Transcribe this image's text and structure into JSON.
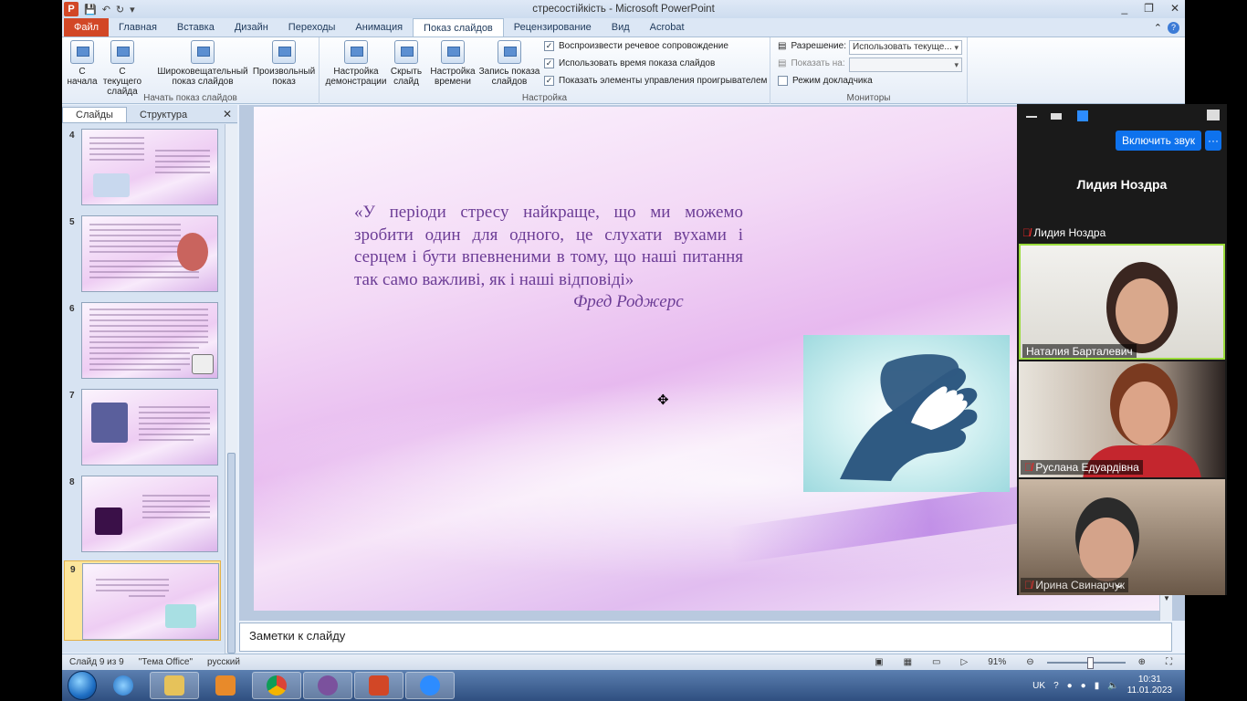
{
  "window": {
    "title": "стресостійкість - Microsoft PowerPoint",
    "controls": [
      "_",
      "❐",
      "✕"
    ]
  },
  "ribbon_tabs": [
    "Файл",
    "Главная",
    "Вставка",
    "Дизайн",
    "Переходы",
    "Анимация",
    "Показ слайдов",
    "Рецензирование",
    "Вид",
    "Acrobat"
  ],
  "active_tab": "Показ слайдов",
  "ribbon": {
    "group_start": {
      "label": "Начать показ слайдов",
      "buttons": [
        "С начала",
        "С текущего слайда",
        "Широковещательный показ слайдов",
        "Произвольный показ"
      ]
    },
    "group_setup": {
      "label": "Настройка",
      "buttons": [
        "Настройка демонстрации",
        "Скрыть слайд",
        "Настройка времени",
        "Запись показа слайдов"
      ],
      "checkboxes": [
        "Воспроизвести речевое сопровождение",
        "Использовать время показа слайдов",
        "Показать элементы управления проигрывателем"
      ]
    },
    "group_monitors": {
      "label": "Мониторы",
      "resolution_label": "Разрешение:",
      "resolution_value": "Использовать текуще...",
      "show_on_label": "Показать на:",
      "presenter_view": "Режим докладчика"
    }
  },
  "left_pane": {
    "tabs": [
      "Слайды",
      "Структура"
    ],
    "close": "✕",
    "slide_numbers": [
      "4",
      "5",
      "6",
      "7",
      "8",
      "9"
    ],
    "selected": "9"
  },
  "slide": {
    "quote": "«У періоди стресу найкраще, що ми можемо зробити один для одного, це слухати вухами і серцем і бути впевненими в тому, що наші питання так само важливі, як і наші відповіді»",
    "author": "Фред Роджерс"
  },
  "notes": {
    "placeholder": "Заметки к слайду"
  },
  "status_bar": {
    "slide_info": "Слайд 9 из 9",
    "theme": "\"Тема Office\"",
    "language": "русский",
    "zoom": "91%"
  },
  "zoom_panel": {
    "unmute_button": "Включить звук",
    "more_button": "···",
    "active_speaker": "Лидия Ноздра",
    "participants": [
      {
        "name": "Лидия Ноздра",
        "muted": true
      },
      {
        "name": "Наталия Барталевич",
        "muted": false
      },
      {
        "name": "Руслана Едуардівна",
        "muted": true
      },
      {
        "name": "Ирина Свинарчук",
        "muted": true
      }
    ],
    "collapse": "⌄"
  },
  "taskbar": {
    "language": "UK",
    "time": "10:31",
    "date": "11.01.2023"
  },
  "colors": {
    "file_tab": "#d24726",
    "slide_text": "#6c3d96",
    "zoom_blue": "#0e72ed",
    "hand_dark": "#2f5a82"
  }
}
